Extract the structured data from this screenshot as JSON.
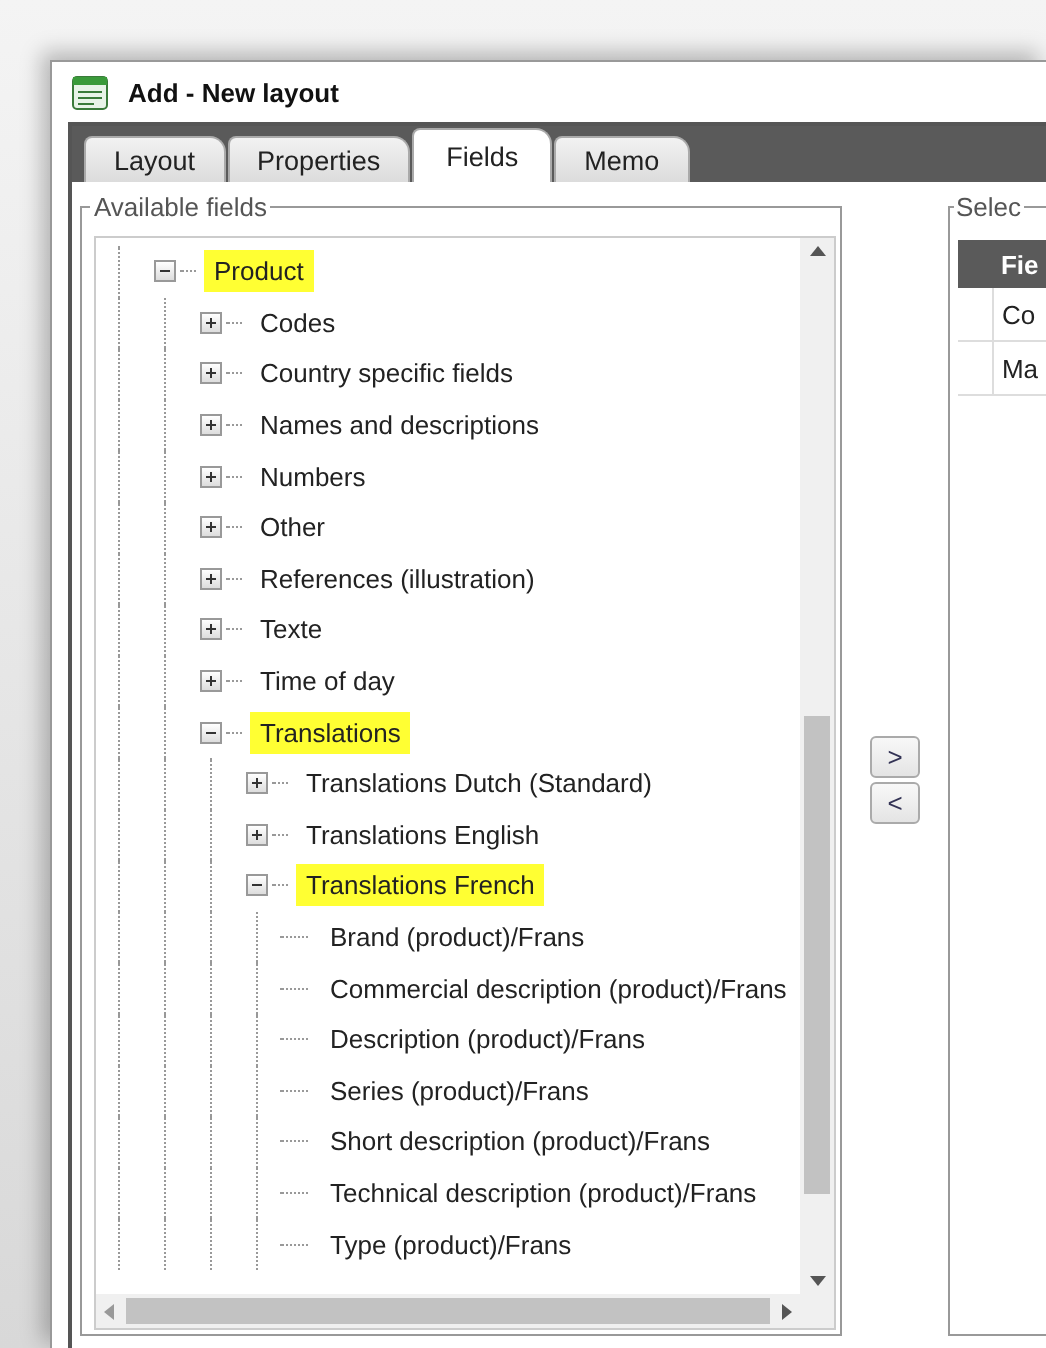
{
  "window": {
    "title": "Add - New layout"
  },
  "tabs": [
    {
      "label": "Layout",
      "selected": false
    },
    {
      "label": "Properties",
      "selected": false
    },
    {
      "label": "Fields",
      "selected": true
    },
    {
      "label": "Memo",
      "selected": false
    }
  ],
  "available_fields": {
    "title": "Available fields",
    "tree": [
      {
        "label": "Product",
        "kind": "folder",
        "expanded": true,
        "highlighted": true,
        "children": [
          {
            "label": "Codes",
            "kind": "folder",
            "expanded": false,
            "highlighted": false
          },
          {
            "label": "Country specific fields",
            "kind": "folder",
            "expanded": false,
            "highlighted": false
          },
          {
            "label": "Names and descriptions",
            "kind": "folder",
            "expanded": false,
            "highlighted": false
          },
          {
            "label": "Numbers",
            "kind": "folder",
            "expanded": false,
            "highlighted": false
          },
          {
            "label": "Other",
            "kind": "folder",
            "expanded": false,
            "highlighted": false
          },
          {
            "label": "References (illustration)",
            "kind": "folder",
            "expanded": false,
            "highlighted": false
          },
          {
            "label": "Texte",
            "kind": "folder",
            "expanded": false,
            "highlighted": false
          },
          {
            "label": "Time of day",
            "kind": "folder",
            "expanded": false,
            "highlighted": false
          },
          {
            "label": "Translations",
            "kind": "folder",
            "expanded": true,
            "highlighted": true,
            "children": [
              {
                "label": "Translations Dutch (Standard)",
                "kind": "folder",
                "expanded": false,
                "highlighted": false
              },
              {
                "label": "Translations English",
                "kind": "folder",
                "expanded": false,
                "highlighted": false
              },
              {
                "label": "Translations French",
                "kind": "folder",
                "expanded": true,
                "highlighted": true,
                "children": [
                  {
                    "label": "Brand (product)/Frans",
                    "kind": "field",
                    "highlighted": false
                  },
                  {
                    "label": "Commercial description (product)/Frans",
                    "kind": "field",
                    "highlighted": false
                  },
                  {
                    "label": "Description (product)/Frans",
                    "kind": "field",
                    "highlighted": false
                  },
                  {
                    "label": "Series (product)/Frans",
                    "kind": "field",
                    "highlighted": false
                  },
                  {
                    "label": "Short description (product)/Frans",
                    "kind": "field",
                    "highlighted": false
                  },
                  {
                    "label": "Technical description (product)/Frans",
                    "kind": "field",
                    "highlighted": false
                  },
                  {
                    "label": "Type (product)/Frans",
                    "kind": "field",
                    "highlighted": false
                  }
                ]
              }
            ]
          }
        ]
      }
    ]
  },
  "move_buttons": [
    ">",
    "<"
  ],
  "selected_fields": {
    "title": "Selec",
    "columns": [
      "Fie"
    ],
    "rows": [
      "Co",
      "Ma"
    ]
  }
}
